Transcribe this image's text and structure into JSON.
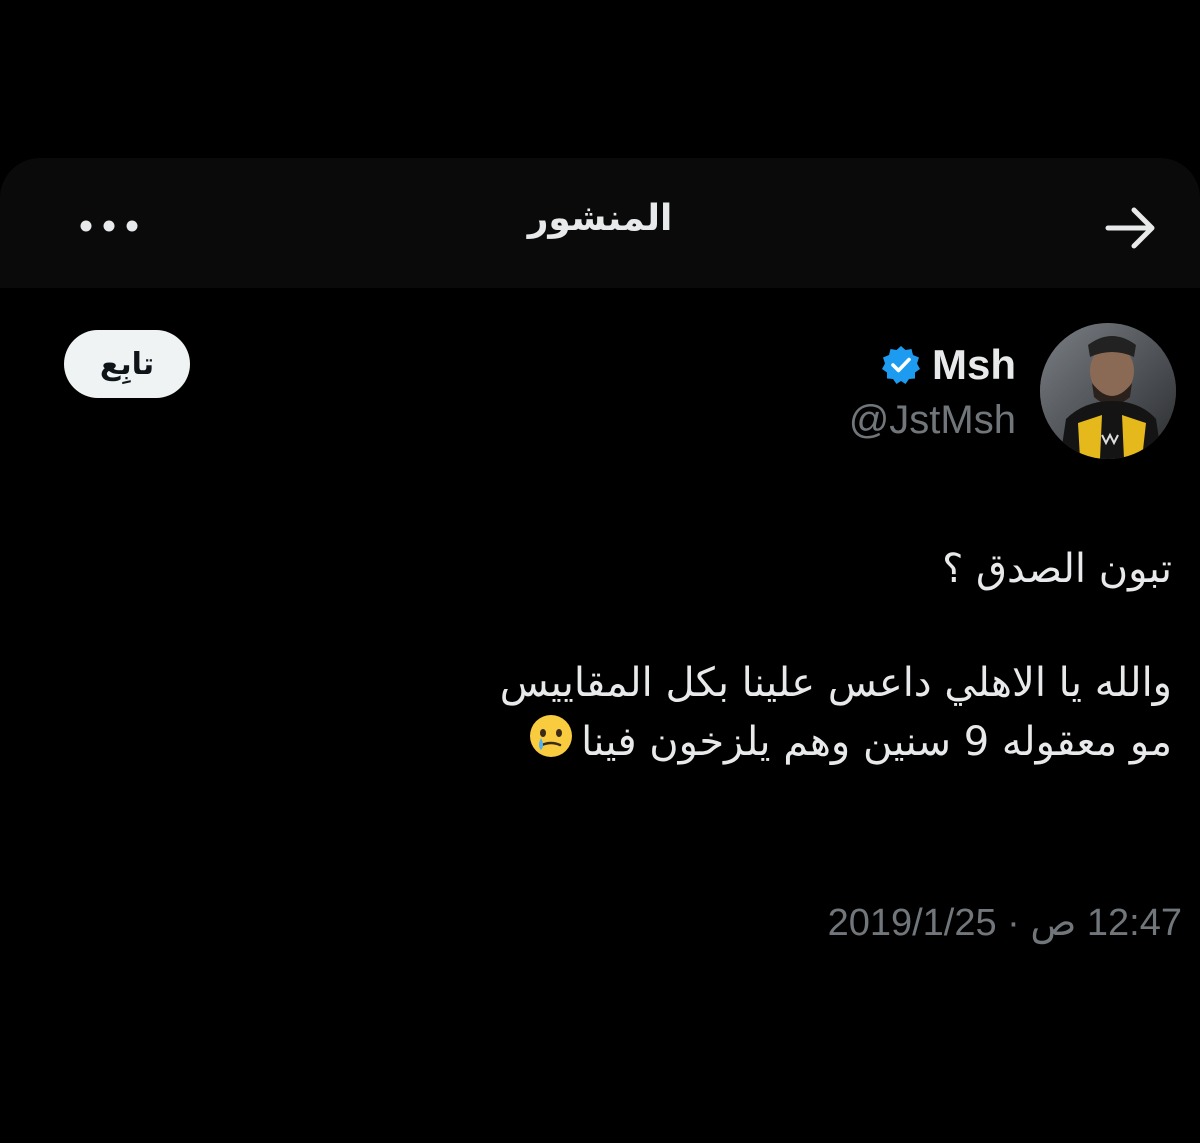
{
  "header": {
    "title": "المنشور",
    "back_icon": "arrow-right-icon",
    "more_icon": "more-horizontal-icon"
  },
  "author": {
    "display_name": "Msh",
    "handle": "@JstMsh",
    "verified_icon": "verified-badge-icon",
    "verified_color": "#1d9bf0"
  },
  "follow_button": {
    "label": "تابِع"
  },
  "tweet": {
    "line1": "تبون الصدق ؟",
    "line2": "والله يا الاهلي داعس علينا بكل المقاييس",
    "line3": "مو معقوله 9 سنين وهم يلزخون فينا",
    "emoji": "face-holding-back-tears-emoji",
    "timestamp": "12:47 ص · 2019/1/25"
  },
  "colors": {
    "background": "#000000",
    "text": "#e7e9ea",
    "muted": "#71767b",
    "button_bg": "#eff3f4"
  }
}
